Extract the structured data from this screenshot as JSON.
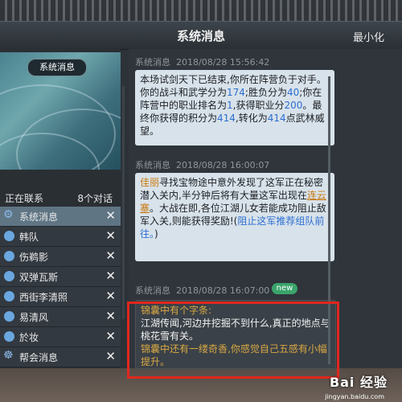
{
  "window": {
    "title": "系统消息",
    "minimize_label": "最小化"
  },
  "sidebar": {
    "banner_label": "系统消息",
    "status_left": "正在联系",
    "status_right": "8个对话",
    "contacts": [
      {
        "name": "系统消息",
        "icon": "gear-icon"
      },
      {
        "name": "韩队",
        "icon": "dot-icon"
      },
      {
        "name": "伤鹈影",
        "icon": "dot-icon"
      },
      {
        "name": "双弹瓦斯",
        "icon": "dot-icon"
      },
      {
        "name": "西街李清照",
        "icon": "dot-icon"
      },
      {
        "name": "易清风",
        "icon": "dot-icon"
      },
      {
        "name": "於妆",
        "icon": "dot-icon"
      },
      {
        "name": "帮会消息",
        "icon": "people-icon"
      }
    ],
    "close_glyph": "✕"
  },
  "messages": [
    {
      "sender": "系统消息",
      "date": "2018/08/28",
      "time": "15:56:42",
      "parts": {
        "p1": "本场试剑天下已结束,你所在阵营负于对手。你的战斗和武学分为",
        "n1": "174",
        "p2": ";胜负分为",
        "n2": "40",
        "p3": ";你在阵营中的职业排名为",
        "n3": "1",
        "p4": ",获得职业分",
        "n4": "200",
        "p5": "。最终你获得的积分为",
        "n5": "414",
        "p6": ",转化为",
        "n6": "414",
        "p7": "点武林威望。"
      }
    },
    {
      "sender": "系统消息",
      "date": "2018/08/28",
      "time": "16:00:07",
      "parts": {
        "name": "佳丽",
        "p1": "寻找宝物途中意外发现了这军正在秘密潜入关内,半分钟后将有大量这军出现在",
        "place": "连云寨",
        "p2": "。大战在即,各位江湖儿女若能成功阻止敌军入关,则能获得奖励!(",
        "blue": "阻止这军推荐组队前往。",
        "p3": ")"
      }
    },
    {
      "sender": "系统消息",
      "date": "2018/08/28",
      "time": "16:07:00",
      "badge": "new",
      "parts": {
        "y1": "锦囊中有个字条:",
        "w1": "江湖传闻,河边井挖掘不到什么,真正的地点与桃花雪有关。",
        "y2": "锦囊中还有一缕奇香,你感觉自己五感有小幅提升。"
      }
    }
  ],
  "watermark": {
    "text": "Bai 经验",
    "sub": "jingyan.baidu.com"
  }
}
